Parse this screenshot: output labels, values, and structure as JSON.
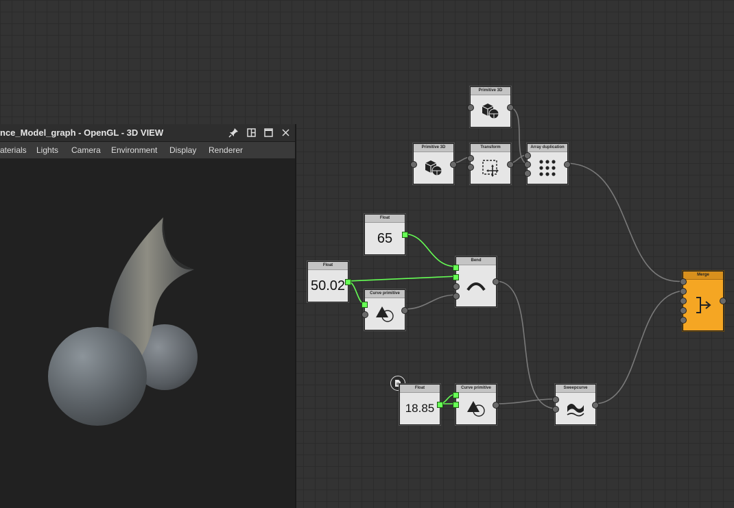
{
  "view3d": {
    "title": "nce_Model_graph - OpenGL - 3D VIEW",
    "menu": [
      "aterials",
      "Lights",
      "Camera",
      "Environment",
      "Display",
      "Renderer"
    ],
    "icons": [
      "pin-icon",
      "split-icon",
      "maximize-icon",
      "close-icon"
    ]
  },
  "nodes": {
    "primitive3d_top": {
      "label": "Primitive 3D",
      "icon": "cube-sphere-icon"
    },
    "primitive3d_left": {
      "label": "Primitive 3D",
      "icon": "cube-sphere-icon"
    },
    "transform": {
      "label": "Transform",
      "icon": "move-selection-icon"
    },
    "array_duplication": {
      "label": "Array duplication",
      "icon": "grid-dots-icon"
    },
    "float_65": {
      "label": "Float",
      "value": "65"
    },
    "float_50": {
      "label": "Float",
      "value": "50.02"
    },
    "curve_primitive_1": {
      "label": "Curve primitive",
      "icon": "triangle-circle-icon"
    },
    "bend": {
      "label": "Bend",
      "icon": "arc-icon"
    },
    "float_18": {
      "label": "Float",
      "value": "18.85"
    },
    "curve_primitive_2": {
      "label": "Curve primitive",
      "icon": "triangle-circle-icon"
    },
    "sweepcurve": {
      "label": "Sweepcurve",
      "icon": "wave-icon"
    },
    "merge": {
      "label": "Merge",
      "icon": "merge-arrow-icon"
    }
  },
  "colors": {
    "canvas": "#333333",
    "node": "#e6e6e6",
    "merge": "#f5a623",
    "active_wire": "#66ff55",
    "wire": "#7a7a7a"
  }
}
